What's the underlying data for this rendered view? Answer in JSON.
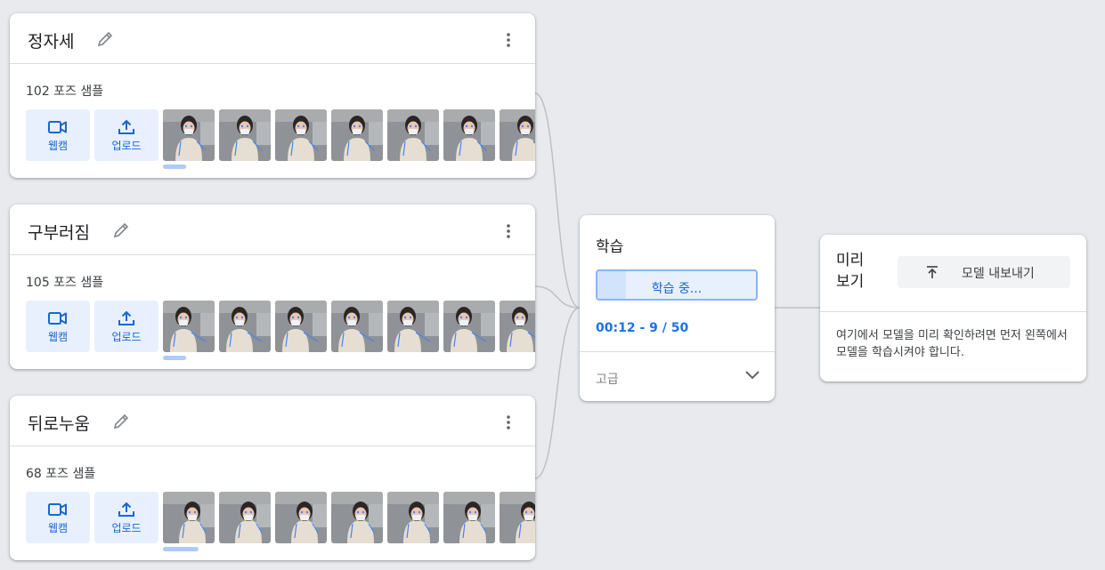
{
  "classes": [
    {
      "name": "정자세",
      "sample_count": "102 포즈 샘플",
      "webcam_label": "웹캠",
      "upload_label": "업로드",
      "pose": "straight"
    },
    {
      "name": "구부러짐",
      "sample_count": "105 포즈 샘플",
      "webcam_label": "웹캠",
      "upload_label": "업로드",
      "pose": "bent"
    },
    {
      "name": "뒤로누움",
      "sample_count": "68 포즈 샘플",
      "webcam_label": "웹캠",
      "upload_label": "업로드",
      "pose": "reclined"
    }
  ],
  "training": {
    "title": "학습",
    "button_label": "학습 중...",
    "status": "00:12 - 9 / 50",
    "progress": 0.18,
    "advanced_label": "고급"
  },
  "preview": {
    "title": "미리 보기",
    "export_label": "모델 내보내기",
    "message": "여기에서 모델을 미리 확인하려면 먼저 왼쪽에서 모델을 학습시켜야 합니다."
  },
  "icons": {
    "edit": "pencil-icon",
    "menu": "more-vert-icon",
    "webcam": "videocam-icon",
    "upload": "upload-icon",
    "advanced": "chevron-down-icon",
    "export": "export-icon"
  },
  "colors": {
    "accent": "#1a73e8",
    "accent_light": "#e8f0fe",
    "background": "#e8eaed"
  }
}
